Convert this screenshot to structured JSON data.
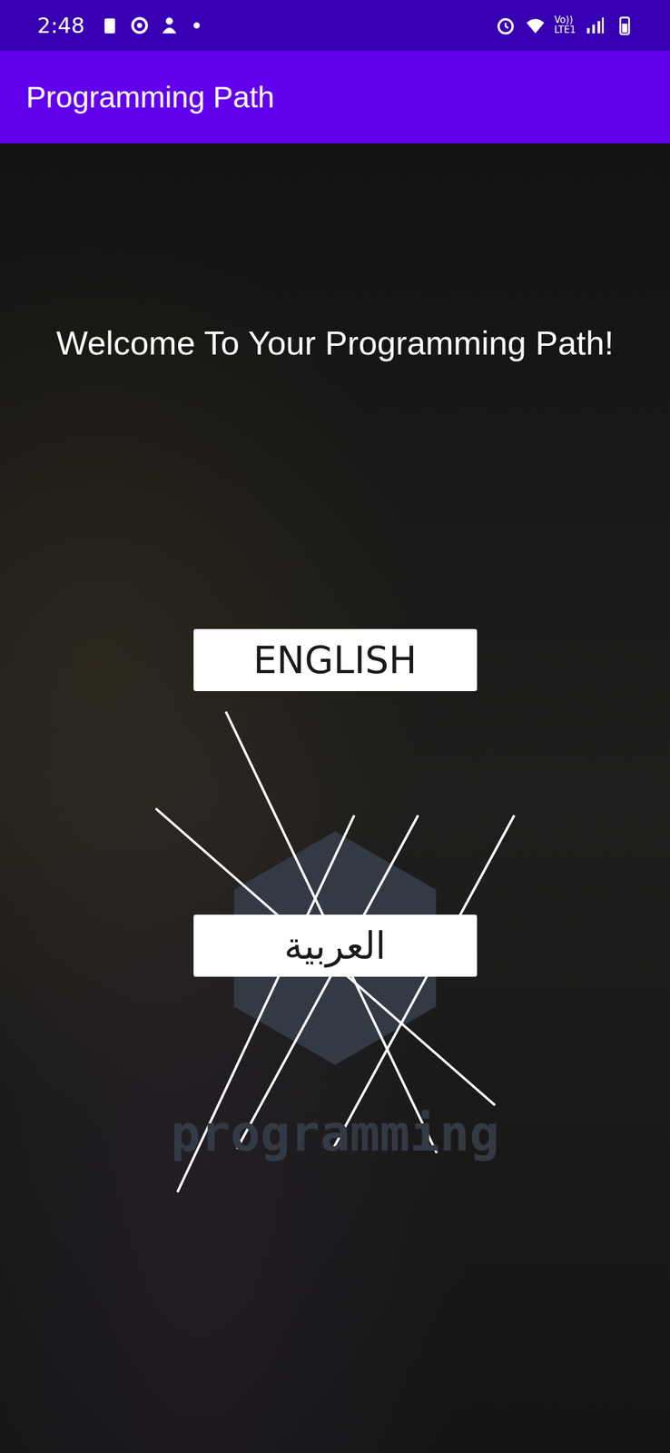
{
  "status_bar": {
    "time": "2:48",
    "network": "Vo))",
    "network_type": "LTE1"
  },
  "app_bar": {
    "title": "Programming Path"
  },
  "welcome": "Welcome To Your Programming Path!",
  "languages": [
    {
      "label": "ENGLISH"
    },
    {
      "label": "العربية"
    }
  ],
  "logo": {
    "text": "programming"
  }
}
